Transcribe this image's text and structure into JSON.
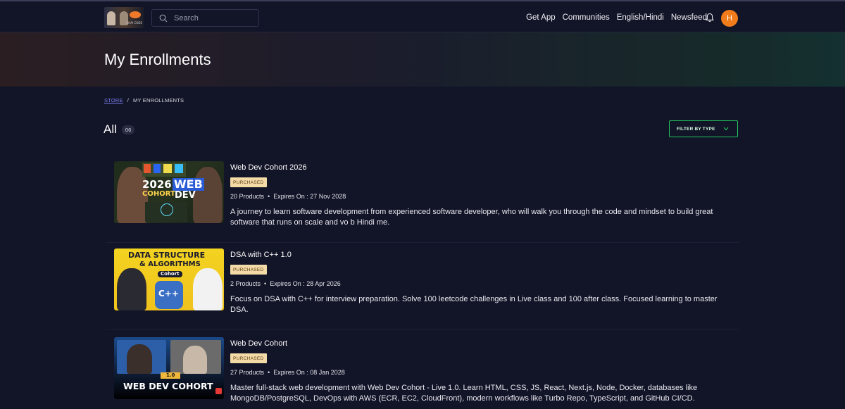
{
  "nav": {
    "search_placeholder": "Search",
    "links": [
      "Get App",
      "Communities",
      "English/Hindi",
      "Newsfeed"
    ],
    "avatar_initial": "H",
    "logo_caption": "CHAI CODE"
  },
  "hero": {
    "title": "My Enrollments"
  },
  "breadcrumb": {
    "store": "STORE",
    "separator": "/",
    "current": "MY ENROLLMENTS"
  },
  "list": {
    "title": "All",
    "count": "06",
    "filter_label": "FILTER BY TYPE"
  },
  "courses": [
    {
      "title": "Web Dev Cohort 2026",
      "badge": "PURCHASED",
      "products": "20 Products",
      "dot": "•",
      "expires": "Expires On : 27 Nov 2028",
      "description": "A journey to learn software development from experienced software developer, who will walk you through the code and mindset to build great software that runs on scale and vo b Hindi me.",
      "thumb": {
        "line1": "2026",
        "line2": "COHORT",
        "line3": "WEB",
        "line4": "DEV"
      }
    },
    {
      "title": "DSA with C++ 1.0",
      "badge": "PURCHASED",
      "products": "2 Products",
      "dot": "•",
      "expires": "Expires On : 28 Apr 2026",
      "description": "Focus on DSA with C++ for interview preparation. Solve 100 leetcode challenges in Live class and 100 after class. Focused learning to master DSA.",
      "thumb": {
        "line1": "DATA STRUCTURE",
        "line2": "& ALGORITHMS",
        "line3": "Cohort",
        "line4": "C++"
      }
    },
    {
      "title": "Web Dev Cohort",
      "badge": "PURCHASED",
      "products": "27 Products",
      "dot": "•",
      "expires": "Expires On : 08 Jan 2028",
      "description": "Master full-stack web development with Web Dev Cohort - Live 1.0. Learn HTML, CSS, JS, React, Next.js, Node, Docker, databases like MongoDB/PostgreSQL, DevOps with AWS (ECR, EC2, CloudFront), modern workflows like Turbo Repo, TypeScript, and GitHub CI/CD.",
      "thumb": {
        "line1": "1.0",
        "line2": "WEB DEV COHORT"
      }
    }
  ],
  "colors": {
    "accent": "#7b7ff0",
    "filter_border": "#22c55e",
    "avatar": "#f07c1c",
    "badge": "#f3dba8"
  }
}
